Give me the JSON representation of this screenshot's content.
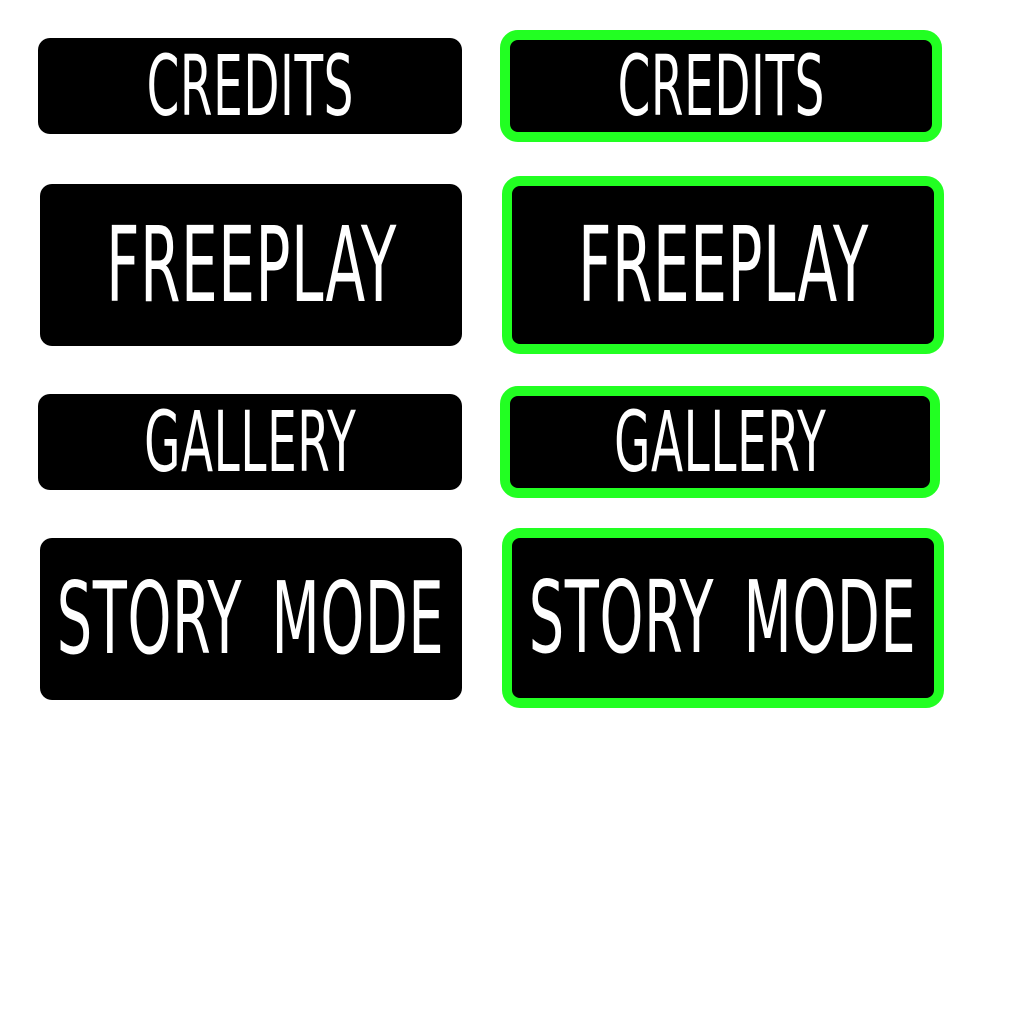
{
  "colors": {
    "background": "#ffffff",
    "button_fill": "#000000",
    "button_text": "#ffffff",
    "selected_outline": "#22ff22"
  },
  "buttons": {
    "credits": {
      "label": "CREDITS"
    },
    "freeplay": {
      "label": "FREEPLAY"
    },
    "gallery": {
      "label": "GALLERY"
    },
    "story_mode": {
      "label": "STORY MODE"
    }
  }
}
